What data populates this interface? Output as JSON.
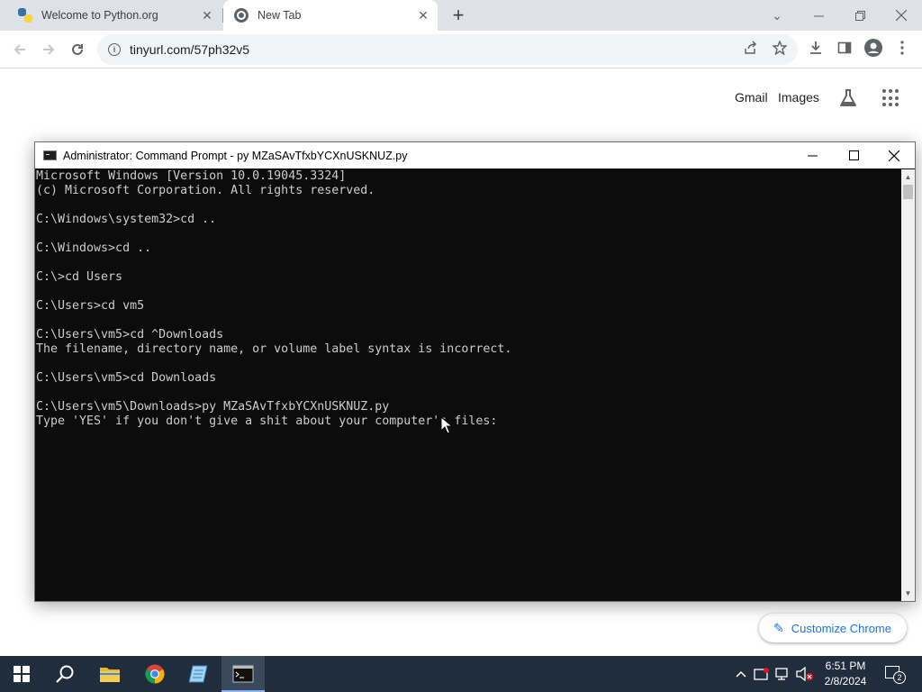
{
  "browser": {
    "tabs": [
      {
        "title": "Welcome to Python.org",
        "favicon": "python-icon"
      },
      {
        "title": "New Tab",
        "favicon": "chrome-icon"
      }
    ],
    "url": "tinyurl.com/57ph32v5",
    "colors": {
      "tabstrip": "#dee1e6",
      "omnibox": "#f1f3f4",
      "accent": "#1a73e8"
    }
  },
  "ntp": {
    "gmail": "Gmail",
    "images": "Images",
    "customize": "Customize Chrome"
  },
  "cmd": {
    "title": "Administrator: Command Prompt - py  MZaSAvTfxbYCXnUSKNUZ.py",
    "lines": [
      "Microsoft Windows [Version 10.0.19045.3324]",
      "(c) Microsoft Corporation. All rights reserved.",
      "",
      "C:\\Windows\\system32>cd ..",
      "",
      "C:\\Windows>cd ..",
      "",
      "C:\\>cd Users",
      "",
      "C:\\Users>cd vm5",
      "",
      "C:\\Users\\vm5>cd ^Downloads",
      "The filename, directory name, or volume label syntax is incorrect.",
      "",
      "C:\\Users\\vm5>cd Downloads",
      "",
      "C:\\Users\\vm5\\Downloads>py MZaSAvTfxbYCXnUSKNUZ.py",
      "Type 'YES' if you don't give a shit about your computer's files:"
    ]
  },
  "taskbar": {
    "time": "6:51 PM",
    "date": "2/8/2024",
    "notification_count": "2"
  }
}
